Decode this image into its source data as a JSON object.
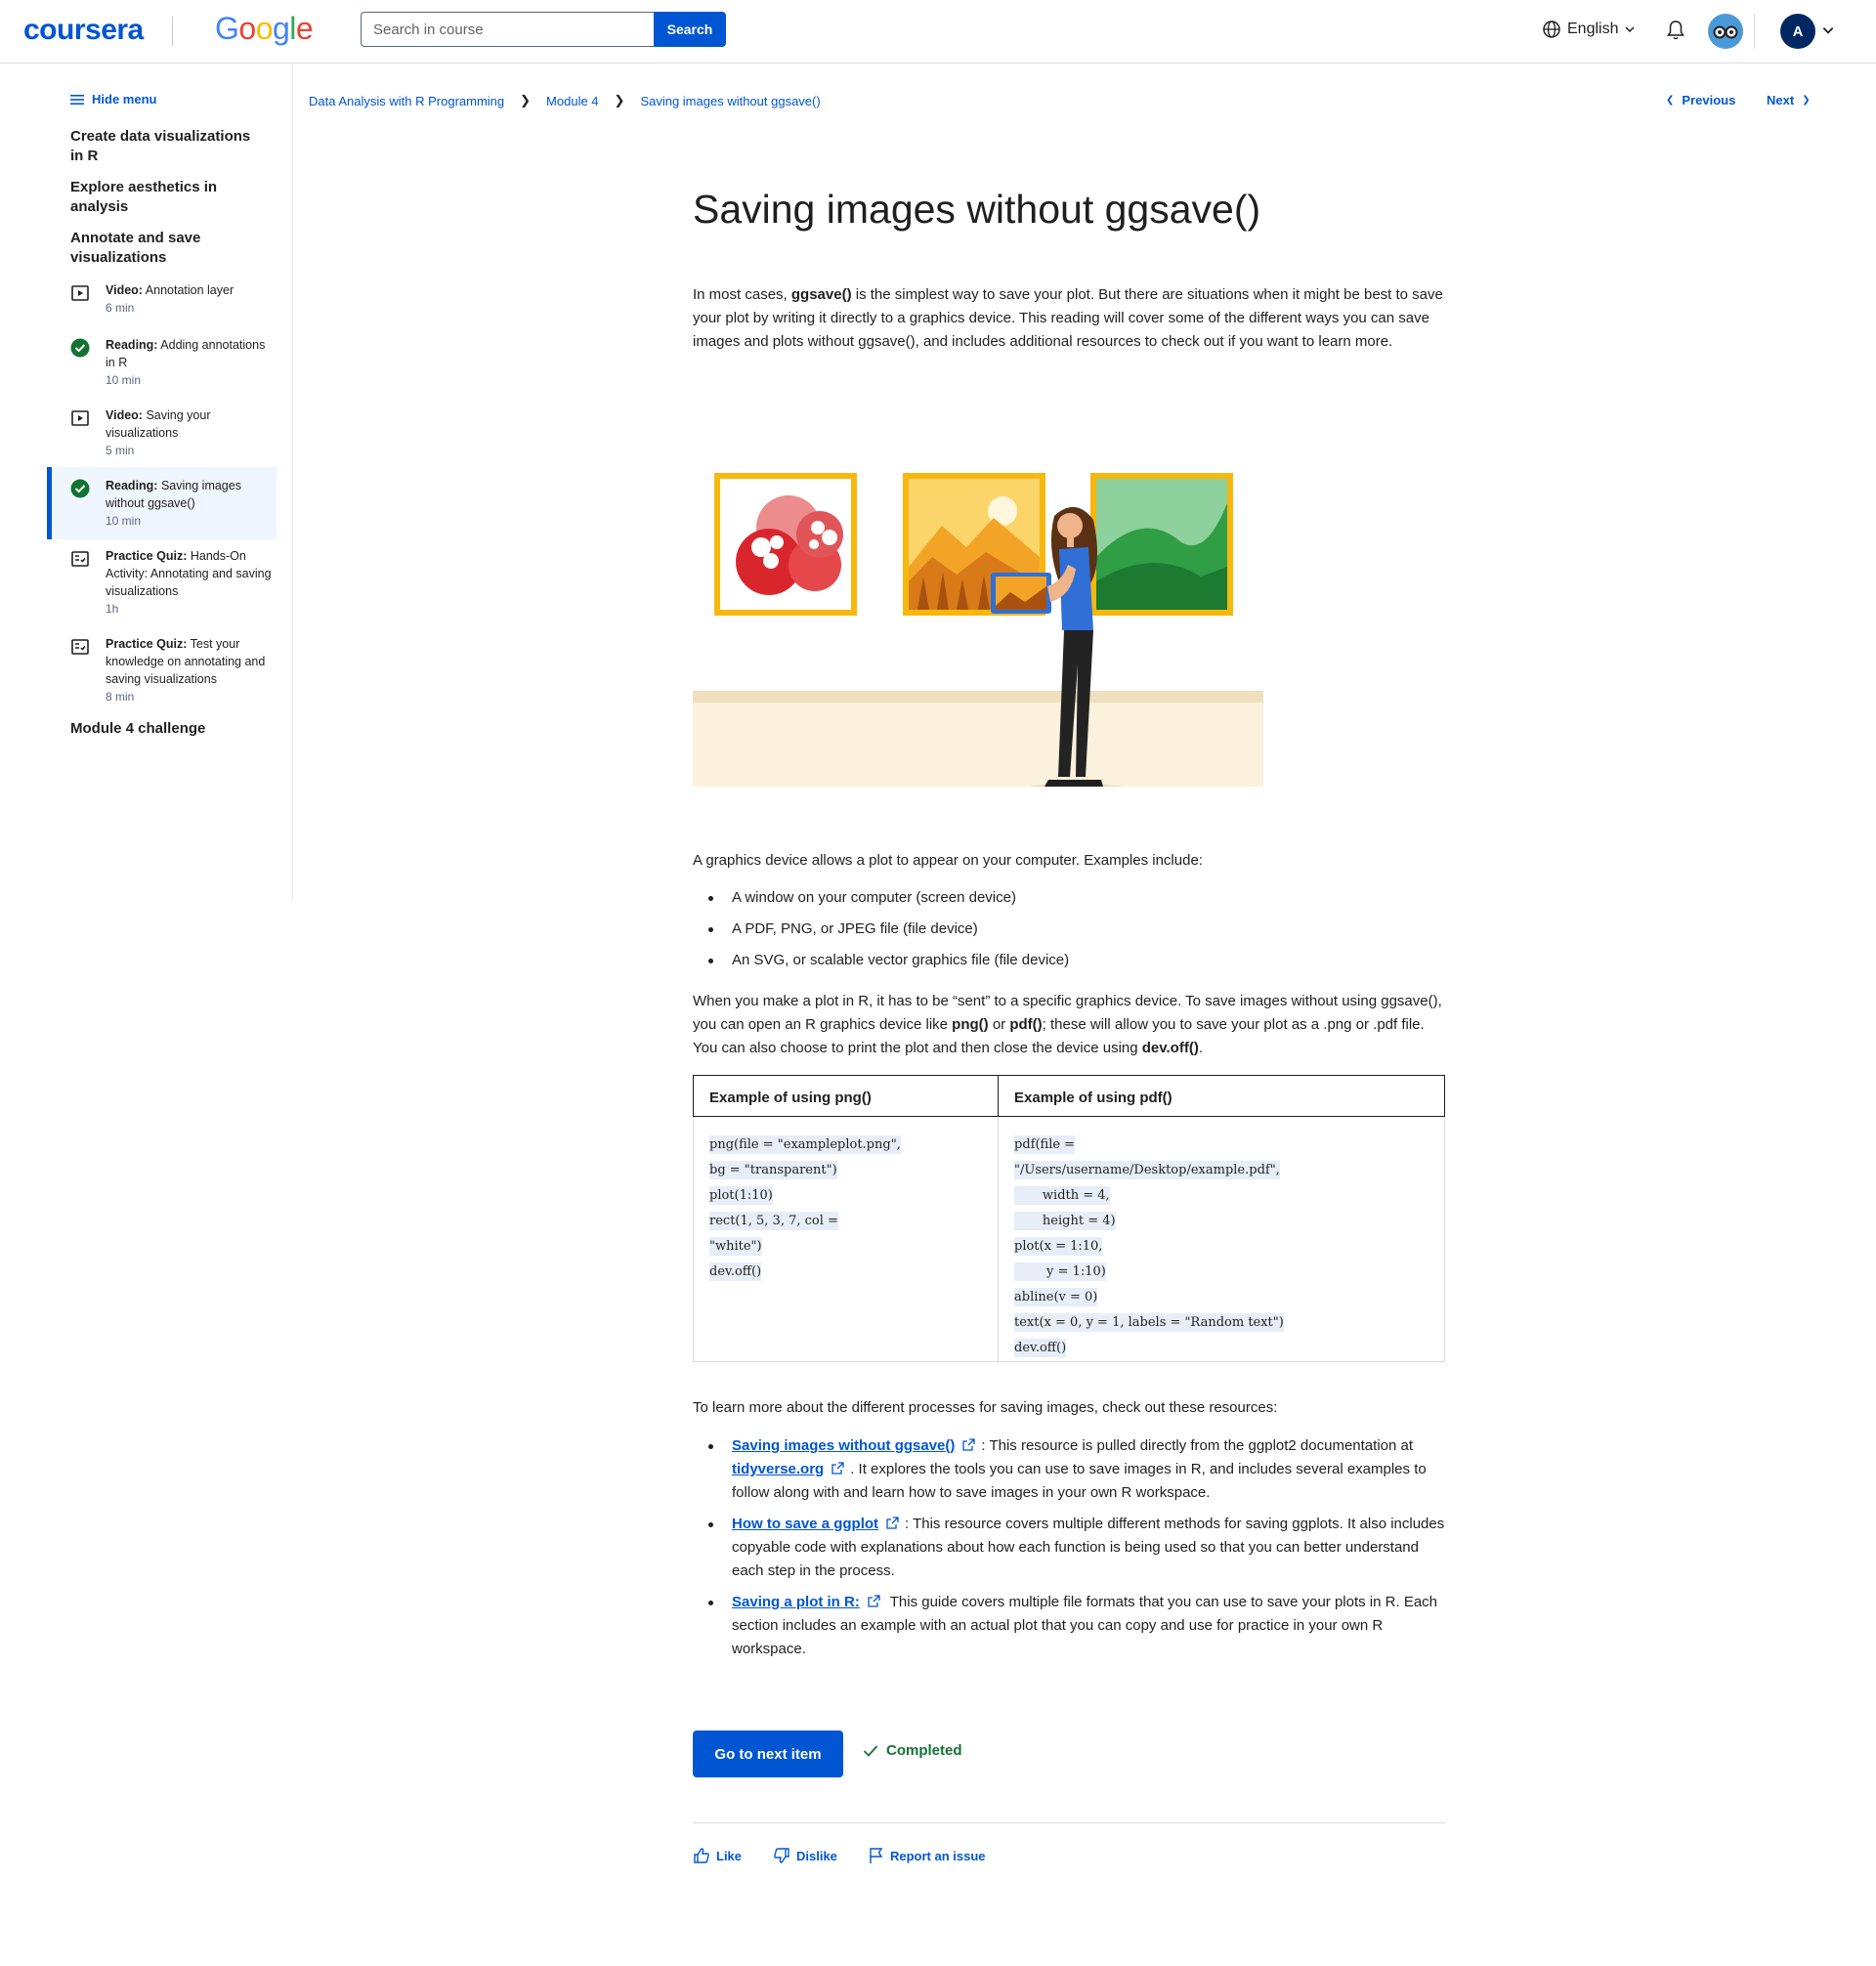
{
  "header": {
    "brand": "coursera",
    "partner": "Google",
    "search_placeholder": "Search in course",
    "search_button": "Search",
    "language": "English",
    "avatar_initial": "A",
    "brand_color": "#0056d2"
  },
  "sidebar": {
    "hide_menu": "Hide menu",
    "sections": [
      "Create data visualizations in R",
      "Explore aesthetics in analysis",
      "Annotate and save visualizations"
    ],
    "items": [
      {
        "type": "Video:",
        "title": "Annotation layer",
        "duration": "6 min",
        "icon": "play-icon",
        "completed": false
      },
      {
        "type": "Reading:",
        "title": "Adding annotations in R",
        "duration": "10 min",
        "icon": "check-circle-icon",
        "completed": true
      },
      {
        "type": "Video:",
        "title": "Saving your visualizations",
        "duration": "5 min",
        "icon": "play-icon",
        "completed": false
      },
      {
        "type": "Reading:",
        "title": "Saving images without ggsave()",
        "duration": "10 min",
        "icon": "check-circle-icon",
        "completed": true,
        "active": true
      },
      {
        "type": "Practice Quiz:",
        "title": "Hands-On Activity: Annotating and saving visualizations",
        "duration": "1h",
        "icon": "quiz-icon",
        "completed": false
      },
      {
        "type": "Practice Quiz:",
        "title": "Test your knowledge on annotating and saving visualizations",
        "duration": "8 min",
        "icon": "quiz-icon",
        "completed": false
      }
    ],
    "footer_section": "Module 4 challenge"
  },
  "breadcrumb": [
    "Data Analysis with R Programming",
    "Module 4",
    "Saving images without ggsave()"
  ],
  "nav": {
    "previous": "Previous",
    "next": "Next"
  },
  "article": {
    "title": "Saving images without ggsave()",
    "intro_pre": "In most cases, ",
    "intro_bold": "ggsave()",
    "intro_post": " is the simplest way to save your plot. But there are situations when it might be best to save your plot by writing it directly to a graphics device. This reading will cover some of the different ways you can save images and plots without ggsave(), and includes additional resources to check out if you want to learn more.",
    "device_intro": "A graphics device allows a plot to appear on your computer. Examples include:",
    "device_examples": [
      "A window on your computer (screen device)",
      "A PDF, PNG, or JPEG file (file device)",
      "An SVG, or scalable vector graphics file (file device)"
    ],
    "para2_a": "When you make a plot in R, it has to be “sent” to a specific graphics device. To save images without using ggsave(), you can open an R graphics device like ",
    "para2_b": "png()",
    "para2_c": " or ",
    "para2_d": "pdf()",
    "para2_e": "; these will allow you to save your plot as a .png or .pdf file. You can also choose to print the plot and then close the device using ",
    "para2_f": "dev.off()",
    "para2_g": ".",
    "table": {
      "headers": [
        "Example of using png()",
        "Example of using pdf()"
      ],
      "png_code": [
        "png(file = \"exampleplot.png\",",
        "bg = \"transparent\")",
        "plot(1:10)",
        "rect(1, 5, 3, 7, col =",
        "\"white\")",
        "dev.off()"
      ],
      "pdf_code": [
        "pdf(file =",
        "\"/Users/username/Desktop/example.pdf\",",
        "       width = 4,",
        "       height = 4)",
        "plot(x = 1:10,",
        "        y = 1:10)",
        "abline(v = 0)",
        "text(x = 0, y = 1, labels = \"Random text\")",
        "dev.off()"
      ]
    },
    "resources_intro": "To learn more about the different processes for saving images, check out these resources:",
    "resources": [
      {
        "link": "Saving images without ggsave()",
        "text_a": ": This resource is pulled directly from the ggplot2 documentation at ",
        "link2": "tidyverse.org",
        "text_b": ". It explores the tools you can use to save images in R, and includes several examples to follow along with and learn how to save images in your own R workspace."
      },
      {
        "link": "How to save a ggplot",
        "text_a": ": This resource covers multiple different methods for saving ggplots. It also includes copyable code with explanations about how each function is being used so that you can better understand each step in the process."
      },
      {
        "link": "Saving a plot in R:",
        "text_a": " This guide covers multiple file formats that you can use to save your plots in R. Each section includes an example with an actual plot that you can copy and use for practice in your own R workspace."
      }
    ]
  },
  "actions": {
    "next_item": "Go to next item",
    "completed": "Completed",
    "like": "Like",
    "dislike": "Dislike",
    "report": "Report an issue"
  }
}
